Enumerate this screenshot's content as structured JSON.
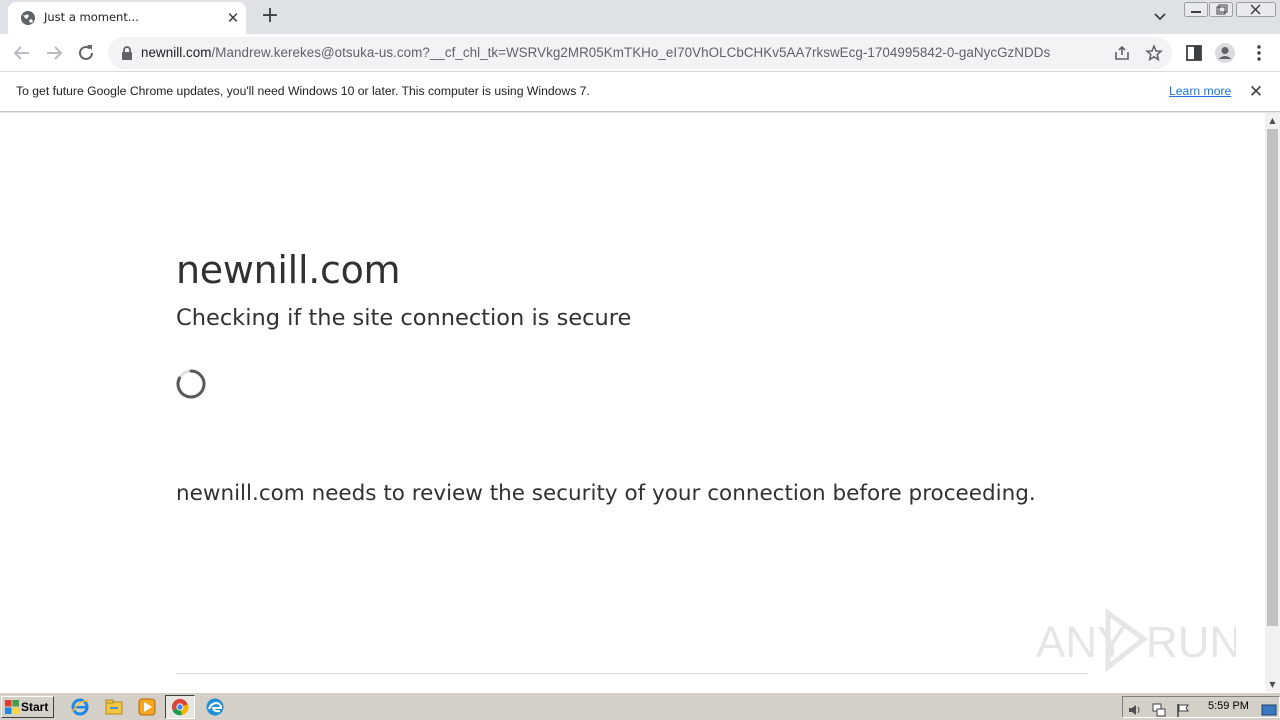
{
  "browser": {
    "tab": {
      "title": "Just a moment..."
    },
    "address": {
      "host": "newnill.com",
      "path": "/Mandrew.kerekes@otsuka-us.com?__cf_chl_tk=WSRVkg2MR05KmTKHo_eI70VhOLCbCHKv5AA7rkswEcg-1704995842-0-gaNycGzNDDs"
    },
    "infobar": {
      "message": "To get future Google Chrome updates, you'll need Windows 10 or later. This computer is using Windows 7.",
      "link": "Learn more"
    }
  },
  "page": {
    "title": "newnill.com",
    "subtitle": "Checking if the site connection is secure",
    "message": "newnill.com needs to review the security of your connection before proceeding."
  },
  "watermark": {
    "text": "ANY RUN"
  },
  "taskbar": {
    "start_label": "Start",
    "clock": "5:59 PM"
  },
  "colors": {
    "tabstrip": "#dee1e6",
    "link": "#1a73e8",
    "text": "#313131",
    "taskbar": "#d4d0c8"
  }
}
